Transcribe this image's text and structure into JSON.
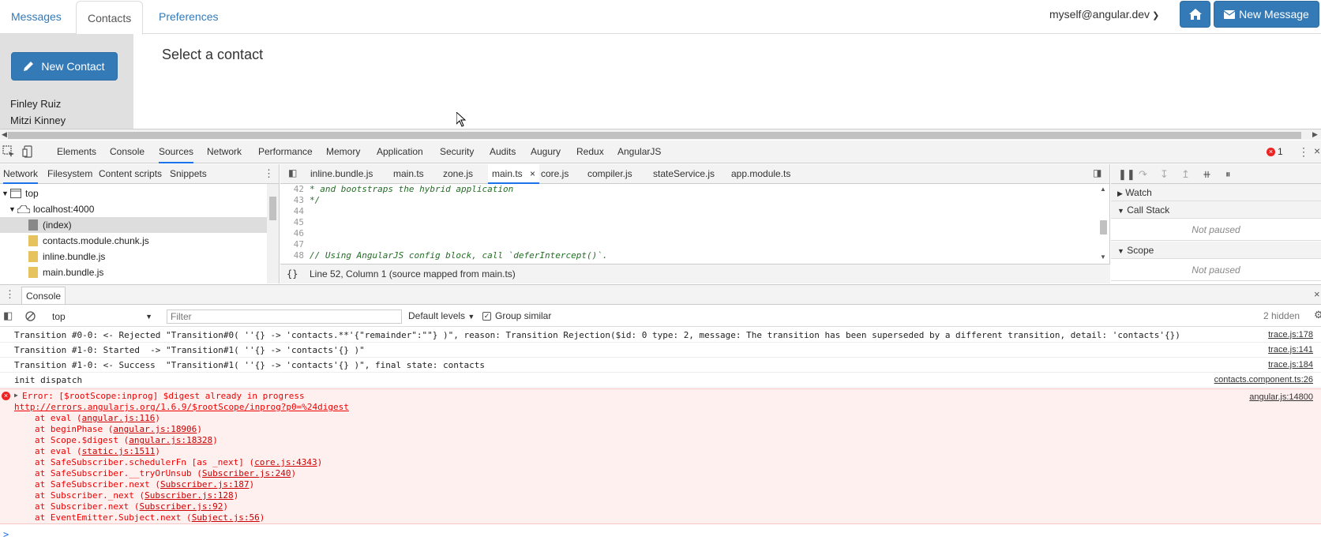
{
  "app": {
    "tabs": [
      {
        "label": "Messages"
      },
      {
        "label": "Contacts"
      },
      {
        "label": "Preferences"
      }
    ],
    "account": "myself@angular.dev",
    "new_message_label": "New Message",
    "new_contact_label": "New Contact",
    "contacts": [
      "Finley Ruiz",
      "Mitzi Kinney"
    ],
    "main_heading": "Select a contact",
    "accent_color": "#337ab7"
  },
  "devtools": {
    "tabs": [
      "Elements",
      "Console",
      "Sources",
      "Network",
      "Performance",
      "Memory",
      "Application",
      "Security",
      "Audits",
      "Augury",
      "Redux",
      "AngularJS"
    ],
    "active_tab": "Sources",
    "error_count": "1",
    "navigator": {
      "subtabs": [
        "Network",
        "Filesystem",
        "Content scripts",
        "Snippets"
      ],
      "tree": [
        {
          "label": "top"
        },
        {
          "label": "localhost:4000"
        },
        {
          "label": "(index)"
        },
        {
          "label": "contacts.module.chunk.js"
        },
        {
          "label": "inline.bundle.js"
        },
        {
          "label": "main.bundle.js"
        }
      ]
    },
    "editor": {
      "tabs": [
        "inline.bundle.js",
        "main.ts",
        "zone.js",
        "main.ts",
        "core.js",
        "compiler.js",
        "stateService.js",
        "app.module.ts"
      ],
      "lines": [
        {
          "num": "42",
          "text": " * and bootstraps the hybrid application"
        },
        {
          "num": "43",
          "text": " */"
        },
        {
          "num": "44",
          "text": ""
        },
        {
          "num": "45",
          "text": ""
        },
        {
          "num": "46",
          "text": ""
        },
        {
          "num": "47",
          "text": ""
        },
        {
          "num": "48",
          "text": "// Using AngularJS config block, call `deferIntercept()`."
        }
      ],
      "status": "Line 52, Column 1  (source mapped from main.ts)"
    },
    "debugger": {
      "watch": "Watch",
      "call_stack": "Call Stack",
      "scope": "Scope",
      "not_paused": "Not paused"
    }
  },
  "console": {
    "drawer_tab": "Console",
    "context": "top",
    "filter_placeholder": "Filter",
    "levels": "Default levels",
    "group_similar": "Group similar",
    "hidden": "2 hidden",
    "messages": [
      {
        "text": "Transition #0-0: <- Rejected \"Transition#0( ''{} -> 'contacts.**'{\"remainder\":\"\"} )\", reason: Transition Rejection($id: 0 type: 2, message: The transition has been superseded by a different transition, detail: 'contacts'{})",
        "source": "trace.js:178"
      },
      {
        "text": "Transition #1-0: Started  -> \"Transition#1( ''{} -> 'contacts'{} )\"",
        "source": "trace.js:141"
      },
      {
        "text": "Transition #1-0: <- Success  \"Transition#1( ''{} -> 'contacts'{} )\", final state: contacts",
        "source": "trace.js:184"
      },
      {
        "text": "init dispatch",
        "source": "contacts.component.ts:26"
      }
    ],
    "error": {
      "message": "Error: [$rootScope:inprog] $digest already in progress",
      "link": "http://errors.angularjs.org/1.6.9/$rootScope/inprog?p0=%24digest",
      "source": "angular.js:14800",
      "stack": [
        {
          "prefix": "at eval (",
          "file": "angular.js:116",
          "suffix": ")"
        },
        {
          "prefix": "at beginPhase (",
          "file": "angular.js:18906",
          "suffix": ")"
        },
        {
          "prefix": "at Scope.$digest (",
          "file": "angular.js:18328",
          "suffix": ")"
        },
        {
          "prefix": "at eval (",
          "file": "static.js:1511",
          "suffix": ")"
        },
        {
          "prefix": "at SafeSubscriber.schedulerFn [as _next] (",
          "file": "core.js:4343",
          "suffix": ")"
        },
        {
          "prefix": "at SafeSubscriber.__tryOrUnsub (",
          "file": "Subscriber.js:240",
          "suffix": ")"
        },
        {
          "prefix": "at SafeSubscriber.next (",
          "file": "Subscriber.js:187",
          "suffix": ")"
        },
        {
          "prefix": "at Subscriber._next (",
          "file": "Subscriber.js:128",
          "suffix": ")"
        },
        {
          "prefix": "at Subscriber.next (",
          "file": "Subscriber.js:92",
          "suffix": ")"
        },
        {
          "prefix": "at EventEmitter.Subject.next (",
          "file": "Subject.js:56",
          "suffix": ")"
        }
      ]
    },
    "prompt": ">"
  }
}
